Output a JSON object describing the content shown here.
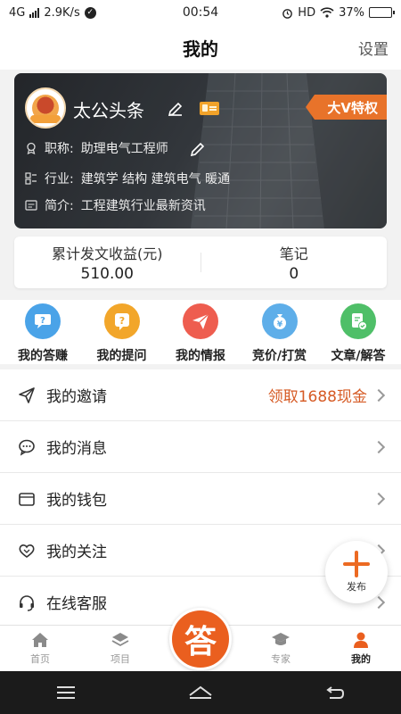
{
  "status_bar": {
    "network": "4G",
    "speed": "2.9K/s",
    "time": "00:54",
    "hd": "HD",
    "battery": "37%",
    "battery_level": 0.37
  },
  "header": {
    "title": "我的",
    "settings": "设置"
  },
  "profile": {
    "name": "太公头条",
    "badge": "大V特权",
    "title_label": "职称:",
    "title_value": "助理电气工程师",
    "industry_label": "行业:",
    "industry_value": "建筑学 结构 建筑电气 暖通",
    "intro_label": "简介:",
    "intro_value": "工程建筑行业最新资讯"
  },
  "stats": [
    {
      "label": "累计发文收益(元)",
      "value": "510.00"
    },
    {
      "label": "笔记",
      "value": "0"
    }
  ],
  "quick_actions": [
    {
      "label": "我的答赚",
      "icon": "qa-chat-icon",
      "color": "#4aa3e8"
    },
    {
      "label": "我的提问",
      "icon": "question-icon",
      "color": "#f2a62a"
    },
    {
      "label": "我的情报",
      "icon": "paper-plane-icon",
      "color": "#ee5d4f"
    },
    {
      "label": "竞价/打赏",
      "icon": "money-bag-icon",
      "color": "#5eaee9"
    },
    {
      "label": "文章/解答",
      "icon": "document-check-icon",
      "color": "#4fbf68"
    }
  ],
  "menu": [
    {
      "label": "我的邀请",
      "extra": "领取1688现金",
      "icon": "send-icon"
    },
    {
      "label": "我的消息",
      "extra": "",
      "icon": "message-icon"
    },
    {
      "label": "我的钱包",
      "extra": "",
      "icon": "wallet-icon"
    },
    {
      "label": "我的关注",
      "extra": "",
      "icon": "heart-icon"
    },
    {
      "label": "在线客服",
      "extra": "",
      "icon": "headset-icon"
    }
  ],
  "fab": {
    "label": "发布"
  },
  "tabs": [
    {
      "label": "首页",
      "icon": "home-icon"
    },
    {
      "label": "项目",
      "icon": "layers-icon"
    },
    {
      "label": "答",
      "icon": "answer-icon"
    },
    {
      "label": "专家",
      "icon": "graduation-cap-icon"
    },
    {
      "label": "我的",
      "icon": "person-icon"
    }
  ],
  "colors": {
    "accent": "#ea5f1f",
    "invite_highlight": "#d65b25"
  }
}
